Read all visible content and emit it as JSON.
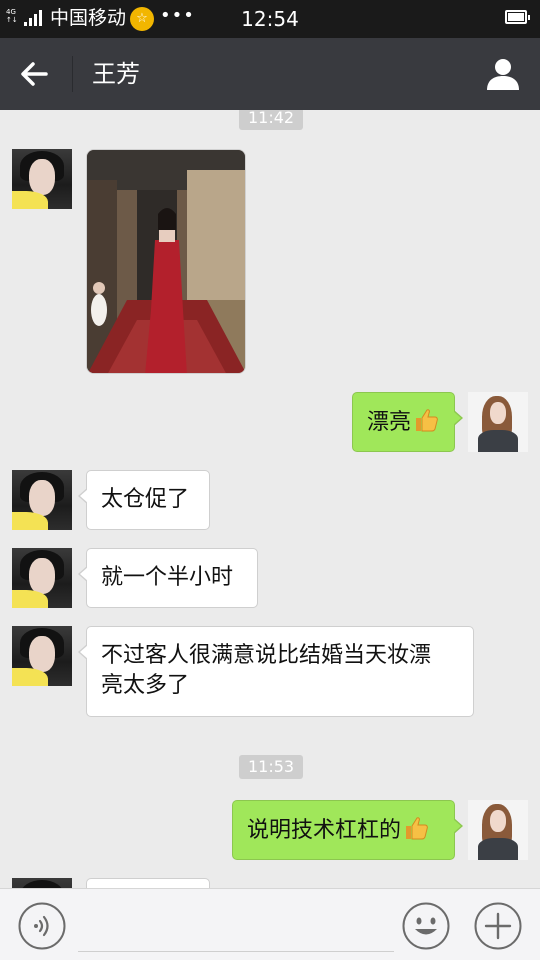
{
  "status_bar": {
    "network_type": "4G 4G",
    "carrier": "中国移动",
    "carrier_badge_icon": "star-badge-icon",
    "overflow_dots": "•••",
    "time": "12:54",
    "battery_icon": "battery-full-icon"
  },
  "header": {
    "title": "王芳",
    "back_icon": "back-arrow-icon",
    "profile_icon": "person-icon",
    "background": "#393a3f"
  },
  "chat": {
    "timestamps": [
      "11:42",
      "11:53"
    ],
    "messages": [
      {
        "side": "left",
        "type": "image",
        "image_description": "photo-of-woman-in-red-dress"
      },
      {
        "side": "right",
        "type": "text",
        "text": "漂亮",
        "emoji": "thumbs-up-icon"
      },
      {
        "side": "left",
        "type": "text",
        "text": "太仓促了"
      },
      {
        "side": "left",
        "type": "text",
        "text": "就一个半小时"
      },
      {
        "side": "left",
        "type": "text",
        "lines": [
          "不过客人很满意说比结婚当天妆漂",
          "亮太多了"
        ]
      },
      {
        "side": "right",
        "type": "text",
        "text": "说明技术杠杠的",
        "emoji": "thumbs-up-icon"
      }
    ],
    "colors": {
      "background": "#ebebeb",
      "outgoing_bubble": "#a0e75a",
      "incoming_bubble": "#ffffff",
      "timestamp_bg": "#cecece"
    }
  },
  "input_bar": {
    "voice_icon": "voice-icon",
    "placeholder": "",
    "emoji_icon": "emoji-icon",
    "plus_icon": "plus-icon"
  }
}
